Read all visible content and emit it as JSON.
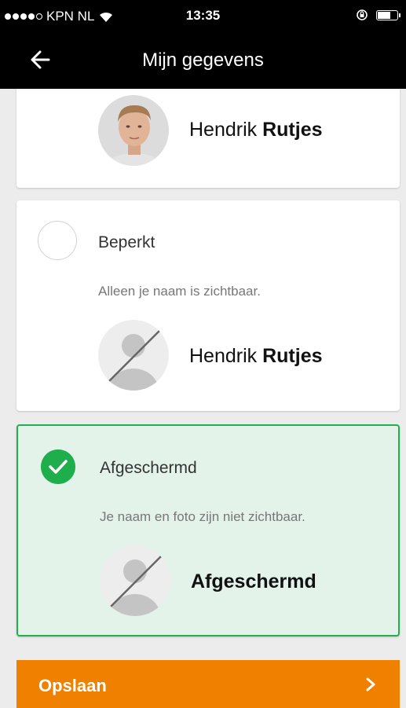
{
  "status_bar": {
    "carrier": "KPN NL",
    "time": "13:35"
  },
  "header": {
    "title": "Mijn gegevens"
  },
  "cards": [
    {
      "first_name": "Hendrik",
      "last_name": "Rutjes"
    },
    {
      "title": "Beperkt",
      "description": "Alleen je naam is zichtbaar.",
      "first_name": "Hendrik",
      "last_name": "Rutjes"
    },
    {
      "title": "Afgeschermd",
      "description": "Je naam en foto zijn niet zichtbaar.",
      "name": "Afgeschermd"
    }
  ],
  "footer": {
    "save_label": "Opslaan"
  },
  "colors": {
    "accent_green": "#1eae4b",
    "selected_bg": "#e3f3ea",
    "save_orange": "#f08000"
  }
}
